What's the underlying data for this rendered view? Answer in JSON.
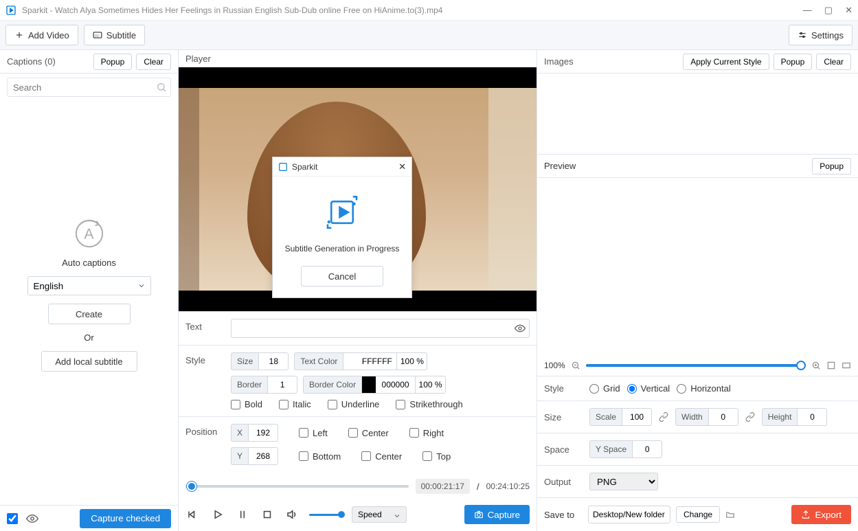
{
  "title": "Sparkit - Watch Alya Sometimes Hides Her Feelings in Russian English Sub-Dub online Free on HiAnime.to(3).mp4",
  "toolbar": {
    "add_video": "Add Video",
    "subtitle": "Subtitle",
    "settings": "Settings"
  },
  "captions": {
    "header": "Captions (0)",
    "popup": "Popup",
    "clear": "Clear",
    "search_placeholder": "Search",
    "auto": "Auto captions",
    "language": "English",
    "create": "Create",
    "or": "Or",
    "add_local": "Add local subtitle",
    "capture_checked": "Capture checked"
  },
  "player": {
    "header": "Player",
    "text": "Text",
    "style_label": "Style",
    "size_label": "Size",
    "size_value": "18",
    "text_color_label": "Text Color",
    "text_color_hex": "FFFFFF",
    "text_color_pct": "100 %",
    "border_label": "Border",
    "border_value": "1",
    "border_color_label": "Border Color",
    "border_color_hex": "000000",
    "border_color_pct": "100 %",
    "bold": "Bold",
    "italic": "Italic",
    "underline": "Underline",
    "strike": "Strikethrough",
    "position": "Position",
    "x_label": "X",
    "x_value": "192",
    "y_label": "Y",
    "y_value": "268",
    "left": "Left",
    "center": "Center",
    "right": "Right",
    "bottom": "Bottom",
    "top": "Top",
    "time_cur": "00:00:21:17",
    "time_sep": "/",
    "time_tot": "00:24:10:25",
    "speed": "Speed",
    "capture": "Capture"
  },
  "images": {
    "header": "Images",
    "apply": "Apply Current Style",
    "popup": "Popup",
    "clear": "Clear"
  },
  "preview": {
    "header": "Preview",
    "popup": "Popup",
    "zoom": "100%",
    "style": "Style",
    "grid": "Grid",
    "vertical": "Vertical",
    "horizontal": "Horizontal",
    "size": "Size",
    "scale": "Scale",
    "scale_v": "100",
    "width": "Width",
    "width_v": "0",
    "height": "Height",
    "height_v": "0",
    "space": "Space",
    "yspace": "Y Space",
    "yspace_v": "0",
    "output": "Output",
    "output_fmt": "PNG",
    "saveto": "Save to",
    "path": "Desktop/New folder",
    "change": "Change",
    "export": "Export"
  },
  "modal": {
    "title": "Sparkit",
    "message": "Subtitle Generation in Progress",
    "cancel": "Cancel"
  }
}
